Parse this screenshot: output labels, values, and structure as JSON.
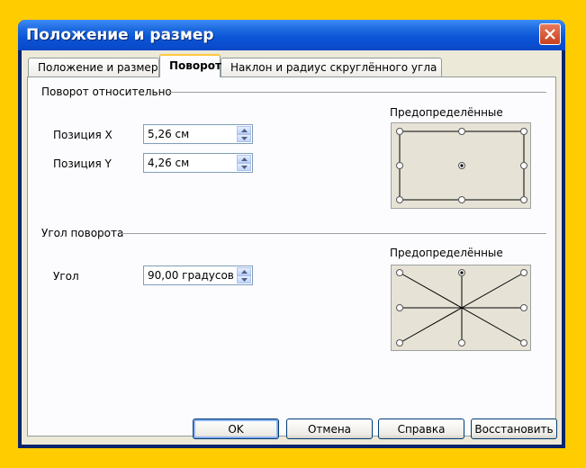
{
  "window": {
    "title": "Положение и размер"
  },
  "tabs": [
    {
      "label": "Положение и размер"
    },
    {
      "label": "Поворот"
    },
    {
      "label": "Наклон и радиус скруглённого угла"
    }
  ],
  "pivot": {
    "section_label": "Поворот относительно",
    "pos_x_label": "Позиция X",
    "pos_x_value": "5,26 см",
    "pos_y_label": "Позиция Y",
    "pos_y_value": "4,26 см",
    "preset_label": "Предопределённые"
  },
  "rotation": {
    "section_label": "Угол поворота",
    "angle_label": "Угол",
    "angle_value": "90,00 градусов",
    "preset_label": "Предопределённые"
  },
  "buttons": {
    "ok": "OK",
    "cancel": "Отмена",
    "help": "Справка",
    "reset": "Восстановить"
  }
}
